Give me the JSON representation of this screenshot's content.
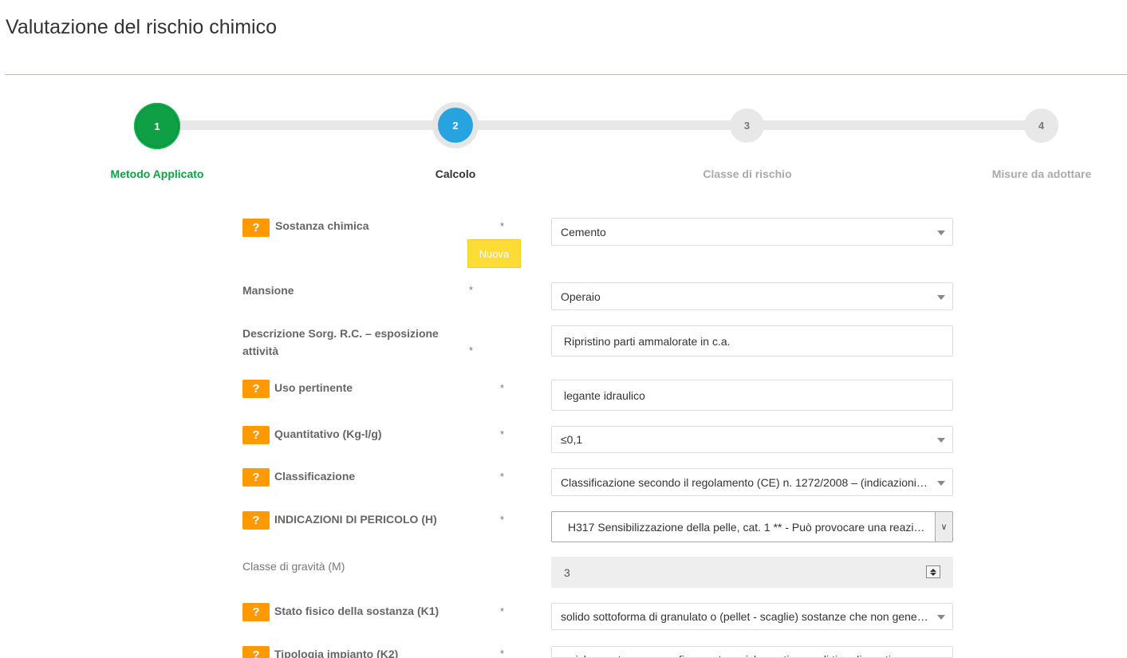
{
  "page_title": "Valutazione del rischio chimico",
  "wizard": {
    "steps": [
      {
        "number": "1",
        "label": "Metodo Applicato"
      },
      {
        "number": "2",
        "label": "Calcolo"
      },
      {
        "number": "3",
        "label": "Classe di rischio"
      },
      {
        "number": "4",
        "label": "Misure da adottare"
      }
    ]
  },
  "colors": {
    "step_done": "#0f9f45",
    "step_active": "#27a4e0",
    "help_button": "#ff9900",
    "nuova_button": "#fddc35",
    "title_rule": "#f2a4a4"
  },
  "form": {
    "help_label": "?",
    "required_mark": "*",
    "nuova_label": "Nuova",
    "sostanza": {
      "label": "Sostanza chimica",
      "value": "Cemento"
    },
    "mansione": {
      "label": "Mansione",
      "value": "Operaio"
    },
    "descrizione": {
      "label": "Descrizione Sorg. R.C. – esposizione attività",
      "value": "Ripristino parti ammalorate in c.a."
    },
    "uso": {
      "label": "Uso pertinente",
      "value": "legante idraulico"
    },
    "quantitativo": {
      "label": "Quantitativo (Kg-l/g)",
      "value": "≤0,1"
    },
    "classificazione": {
      "label": "Classificazione",
      "value": "Classificazione secondo il regolamento (CE) n. 1272/2008 – (indicazioni di pericolo)"
    },
    "indicazioni": {
      "label": "INDICAZIONI DI PERICOLO (H)",
      "value": "H317 Sensibilizzazione della pelle, cat. 1 ** - Può provocare una reazione allergica cutanea"
    },
    "gravita": {
      "label": "Classe di gravità (M)",
      "value": "3"
    },
    "stato_fisico": {
      "label": "Stato fisico della sostanza (K1)",
      "value": "solido sottoforma di granulato o (pellet - scaglie) sostanze che non generano polveri"
    },
    "tipologia": {
      "label": "Tipologia impianto (K2)",
      "value": "a ciclo aperto o con confinamento a ciclo continuo o di tipo discontinuo"
    }
  }
}
